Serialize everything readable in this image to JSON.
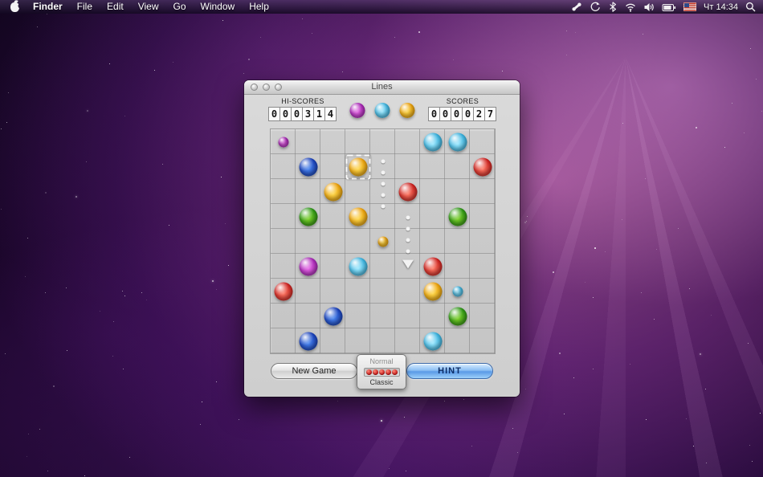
{
  "menu_bar": {
    "items": [
      "Finder",
      "File",
      "Edit",
      "View",
      "Go",
      "Window",
      "Help"
    ],
    "clock": "Чт 14:34"
  },
  "window": {
    "title": "Lines",
    "hi_scores": {
      "label": "HI-SCORES",
      "digits": [
        "0",
        "0",
        "0",
        "3",
        "1",
        "4"
      ]
    },
    "scores": {
      "label": "SCORES",
      "digits": [
        "0",
        "0",
        "0",
        "0",
        "2",
        "7"
      ]
    },
    "next_balls": [
      "magenta",
      "cyan",
      "yellow"
    ],
    "controls": {
      "new_game_label": "New Game",
      "hint_label": "HINT",
      "difficulty": {
        "selected": "Normal",
        "other": "Classic",
        "dots": 5
      }
    }
  },
  "board": {
    "rows": 9,
    "cols": 9,
    "balls": [
      {
        "row": 1,
        "col": 1,
        "color": "magenta",
        "small": true
      },
      {
        "row": 1,
        "col": 7,
        "color": "cyan",
        "small": false
      },
      {
        "row": 1,
        "col": 8,
        "color": "cyan",
        "small": false
      },
      {
        "row": 2,
        "col": 2,
        "color": "blue",
        "small": false
      },
      {
        "row": 2,
        "col": 4,
        "color": "yellow",
        "small": false
      },
      {
        "row": 2,
        "col": 9,
        "color": "red",
        "small": false
      },
      {
        "row": 3,
        "col": 3,
        "color": "yellow",
        "small": false
      },
      {
        "row": 3,
        "col": 6,
        "color": "red",
        "small": false
      },
      {
        "row": 4,
        "col": 2,
        "color": "green",
        "small": false
      },
      {
        "row": 4,
        "col": 4,
        "color": "yellow",
        "small": false
      },
      {
        "row": 4,
        "col": 8,
        "color": "green",
        "small": false
      },
      {
        "row": 5,
        "col": 5,
        "color": "yellow",
        "small": true
      },
      {
        "row": 6,
        "col": 2,
        "color": "magenta",
        "small": false
      },
      {
        "row": 6,
        "col": 4,
        "color": "cyan",
        "small": false
      },
      {
        "row": 6,
        "col": 7,
        "color": "red",
        "small": false
      },
      {
        "row": 7,
        "col": 1,
        "color": "red",
        "small": false
      },
      {
        "row": 7,
        "col": 7,
        "color": "yellow",
        "small": false
      },
      {
        "row": 7,
        "col": 8,
        "color": "cyan",
        "small": true
      },
      {
        "row": 8,
        "col": 3,
        "color": "blue",
        "small": false
      },
      {
        "row": 8,
        "col": 8,
        "color": "green",
        "small": false
      },
      {
        "row": 9,
        "col": 2,
        "color": "blue",
        "small": false
      },
      {
        "row": 9,
        "col": 7,
        "color": "cyan",
        "small": false
      }
    ],
    "selected": {
      "row": 2,
      "col": 4
    },
    "path_dots": [
      {
        "row": 1.8,
        "col": 5
      },
      {
        "row": 2.25,
        "col": 5
      },
      {
        "row": 2.7,
        "col": 5
      },
      {
        "row": 3.15,
        "col": 5
      },
      {
        "row": 3.6,
        "col": 5
      },
      {
        "row": 4.05,
        "col": 6
      },
      {
        "row": 4.5,
        "col": 6
      },
      {
        "row": 4.95,
        "col": 6
      },
      {
        "row": 5.4,
        "col": 6
      }
    ],
    "target": {
      "row": 5.92,
      "col": 6
    }
  },
  "colors": {
    "red": [
      "#ff7a66",
      "#c41212"
    ],
    "yellow": [
      "#ffd84a",
      "#e89800"
    ],
    "green": [
      "#7ed32a",
      "#1f8a10"
    ],
    "blue": [
      "#4a86f0",
      "#1034b0"
    ],
    "cyan": [
      "#9ae8ff",
      "#28a8d8"
    ],
    "magenta": [
      "#e86ae8",
      "#9c1aac"
    ]
  }
}
